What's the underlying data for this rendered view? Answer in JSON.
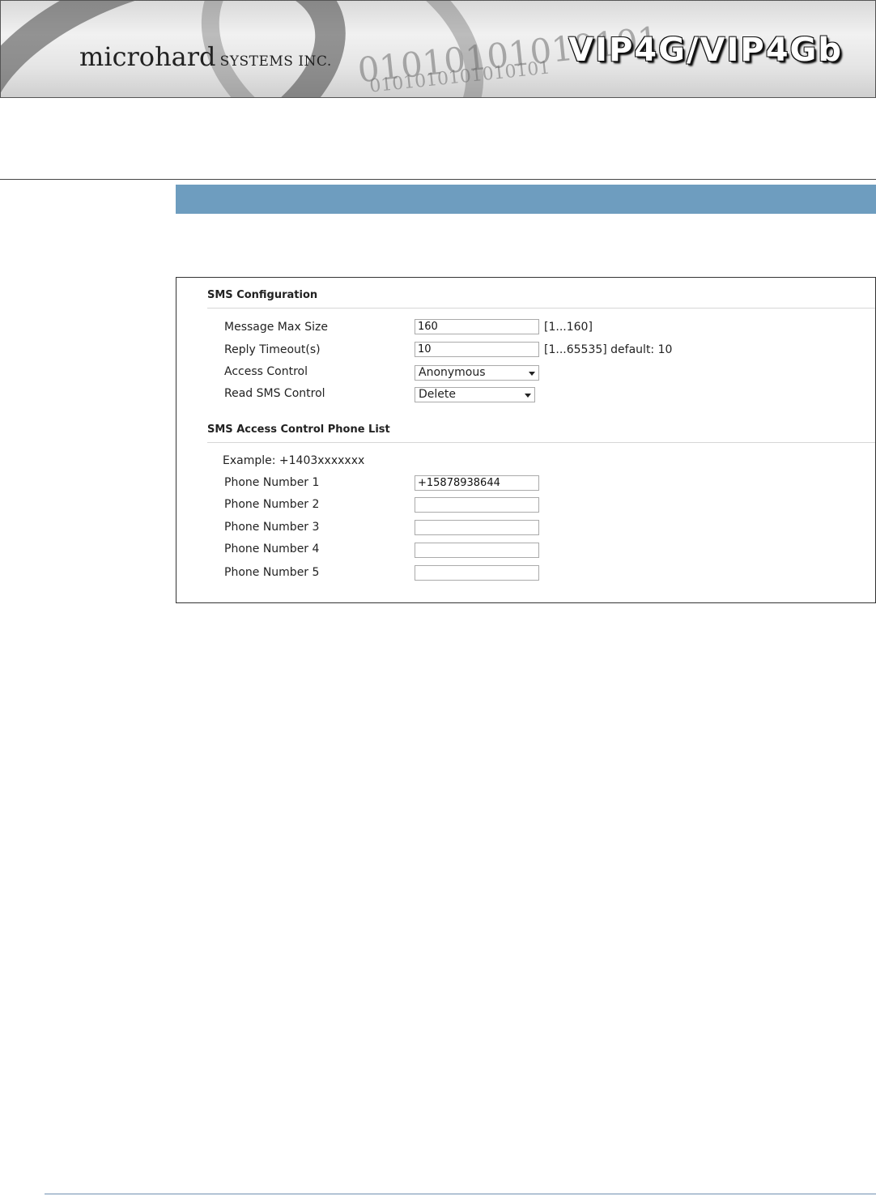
{
  "banner": {
    "brand_big": "microhard",
    "brand_small": "SYSTEMS INC.",
    "binary_line1": "01010101010101",
    "binary_line2": "0101010101010101",
    "product": "VIP4G/VIP4Gb"
  },
  "sms_config": {
    "title": "SMS Configuration",
    "fields": {
      "message_max_size": {
        "label": "Message Max Size",
        "value": "160",
        "hint": "[1...160]"
      },
      "reply_timeout": {
        "label": "Reply Timeout(s)",
        "value": "10",
        "hint": "[1...65535] default: 10"
      },
      "access_control": {
        "label": "Access Control",
        "selected": "Anonymous"
      },
      "read_sms_control": {
        "label": "Read SMS Control",
        "selected": "Delete"
      }
    }
  },
  "phone_list": {
    "title": "SMS Access Control Phone List",
    "example": "Example: +1403xxxxxxx",
    "phones": [
      {
        "label": "Phone Number 1",
        "value": "+15878938644"
      },
      {
        "label": "Phone Number 2",
        "value": ""
      },
      {
        "label": "Phone Number 3",
        "value": ""
      },
      {
        "label": "Phone Number 4",
        "value": ""
      },
      {
        "label": "Phone Number 5",
        "value": ""
      }
    ]
  },
  "colors": {
    "section_bar": "#6e9dbf",
    "panel_border": "#333333"
  }
}
